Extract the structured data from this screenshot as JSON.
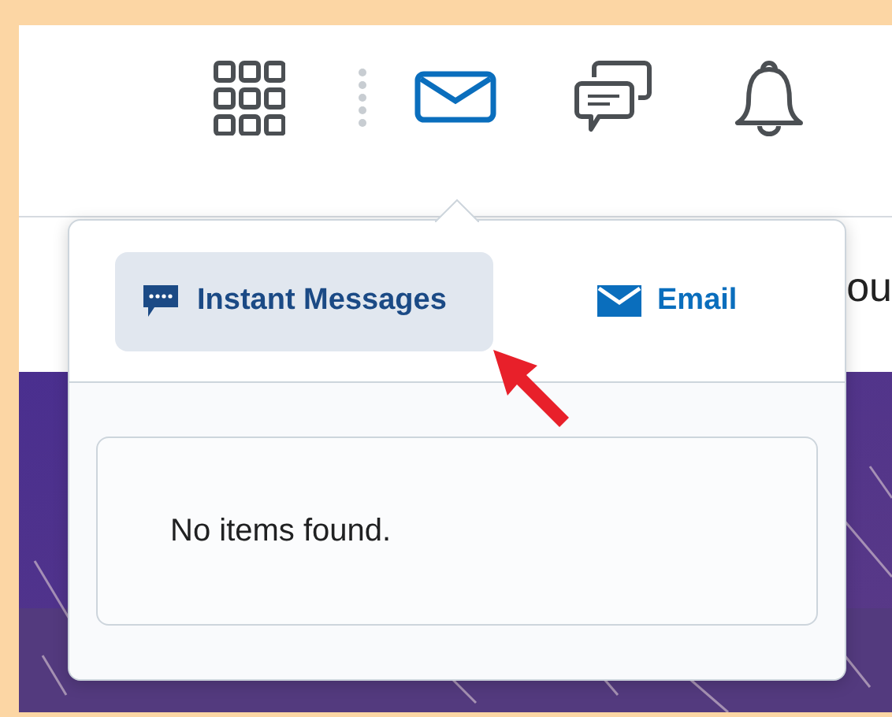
{
  "header": {
    "icons": [
      {
        "kind": "grid",
        "selected": false
      },
      {
        "kind": "divider",
        "selected": false
      },
      {
        "kind": "mail",
        "selected": true
      },
      {
        "kind": "chat",
        "selected": false
      },
      {
        "kind": "bell",
        "selected": false
      }
    ]
  },
  "background_text": "ou",
  "popover": {
    "tabs": [
      {
        "label": "Instant Messages",
        "kind": "chat",
        "selected": true
      },
      {
        "label": "Email",
        "kind": "mail",
        "selected": false
      }
    ],
    "empty_message": "No items found."
  }
}
